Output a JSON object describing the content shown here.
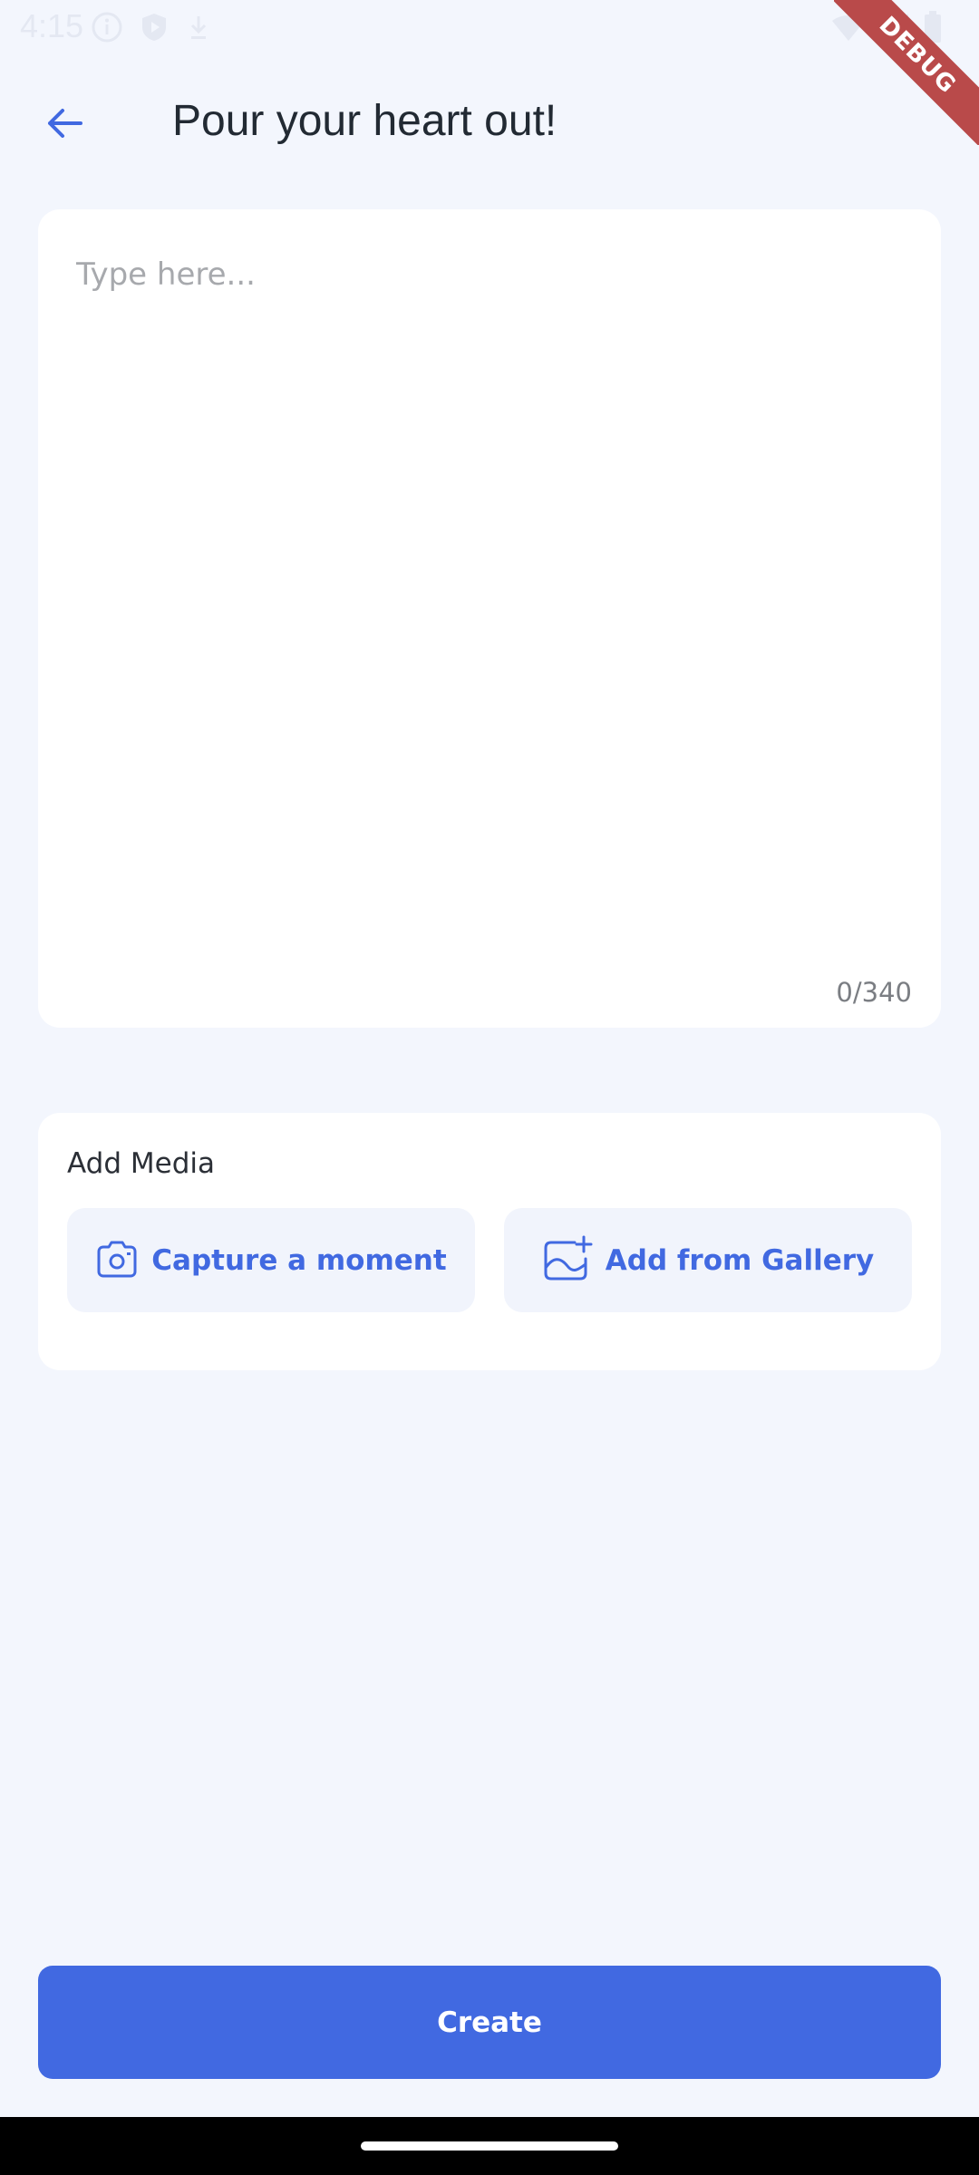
{
  "status_bar": {
    "time": "4:15",
    "debug_label": "DEBUG"
  },
  "app_bar": {
    "title": "Pour your heart out!"
  },
  "editor": {
    "placeholder": "Type here...",
    "value": "",
    "counter": "0/340"
  },
  "media": {
    "label": "Add Media",
    "capture_label": "Capture a moment",
    "gallery_label": "Add from Gallery"
  },
  "actions": {
    "create_label": "Create"
  },
  "colors": {
    "accent": "#4169e1",
    "background": "#f3f6fd",
    "card": "#ffffff",
    "title_text": "#222a33"
  },
  "icons": {
    "back": "arrow-left-icon",
    "capture": "camera-icon",
    "gallery": "image-add-icon"
  }
}
